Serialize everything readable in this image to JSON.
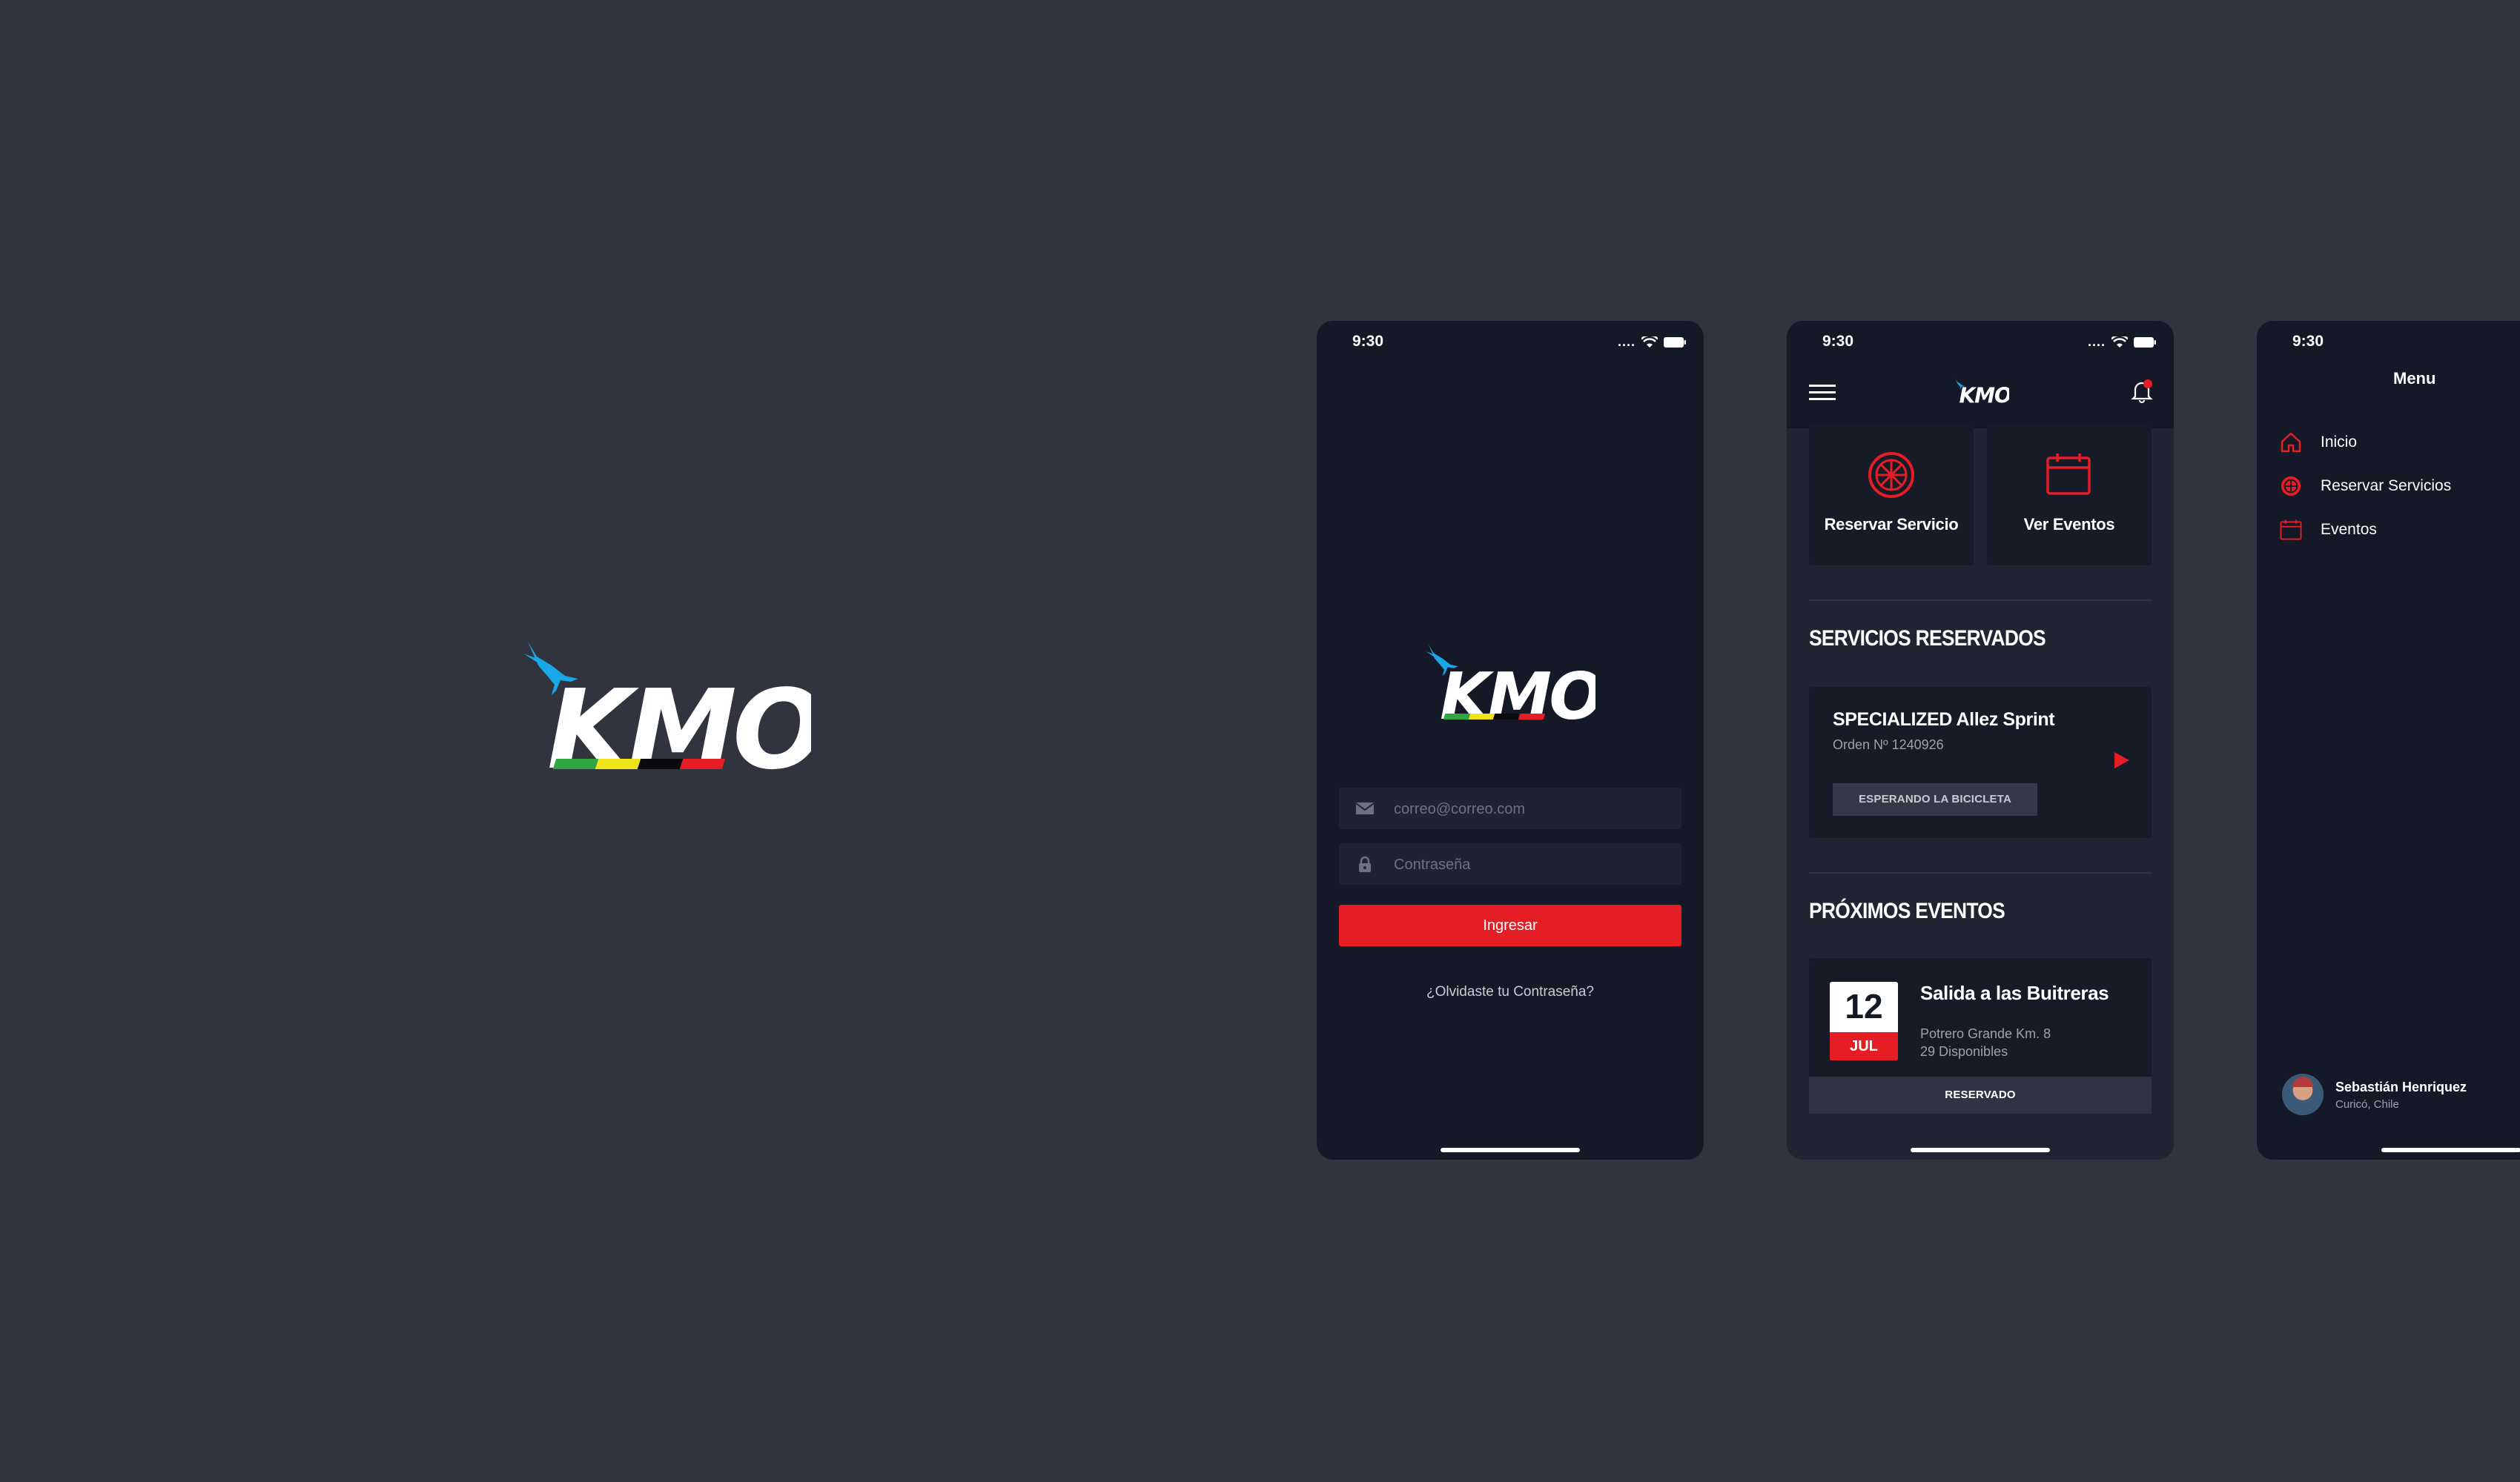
{
  "brand": {
    "logo_text": "KMO",
    "stripe_colors": [
      "#31a543",
      "#f1e31a",
      "#000000",
      "#e51d25"
    ],
    "bird_color": "#1aa7e8"
  },
  "status_bar": {
    "time": "9:30",
    "signal": "....",
    "icons": [
      "signal-icon",
      "wifi-icon",
      "battery-icon"
    ]
  },
  "login": {
    "email_placeholder": "correo@correo.com",
    "password_placeholder": "Contraseña",
    "submit_label": "Ingresar",
    "forgot_link": "¿Olvidaste tu Contraseña?"
  },
  "dashboard": {
    "quick_actions": [
      {
        "label": "Reservar Servicio",
        "icon": "wheel-icon"
      },
      {
        "label": "Ver Eventos",
        "icon": "calendar-icon"
      }
    ],
    "reserved_section_title": "SERVICIOS RESERVADOS",
    "reserved_service": {
      "name": "SPECIALIZED Allez Sprint",
      "order": "Orden Nº 1240926",
      "status": "ESPERANDO LA BICICLETA"
    },
    "events_section_title": "PRÓXIMOS EVENTOS",
    "event": {
      "day": "12",
      "month": "JUL",
      "title": "Salida a las Buitreras",
      "location": "Potrero Grande Km. 8",
      "availability": "29 Disponibles",
      "status": "RESERVADO"
    }
  },
  "menu": {
    "title": "Menu",
    "items": [
      {
        "label": "Inicio",
        "icon": "home-icon"
      },
      {
        "label": "Reservar Servicios",
        "icon": "wheel-icon"
      },
      {
        "label": "Eventos",
        "icon": "calendar-icon"
      }
    ],
    "user": {
      "name": "Sebastián Henriquez",
      "location": "Curicó, Chile"
    }
  },
  "colors": {
    "background": "#31333f",
    "phone_dark": "#151927",
    "accent_red": "#e51d25",
    "card": "#171b28"
  }
}
